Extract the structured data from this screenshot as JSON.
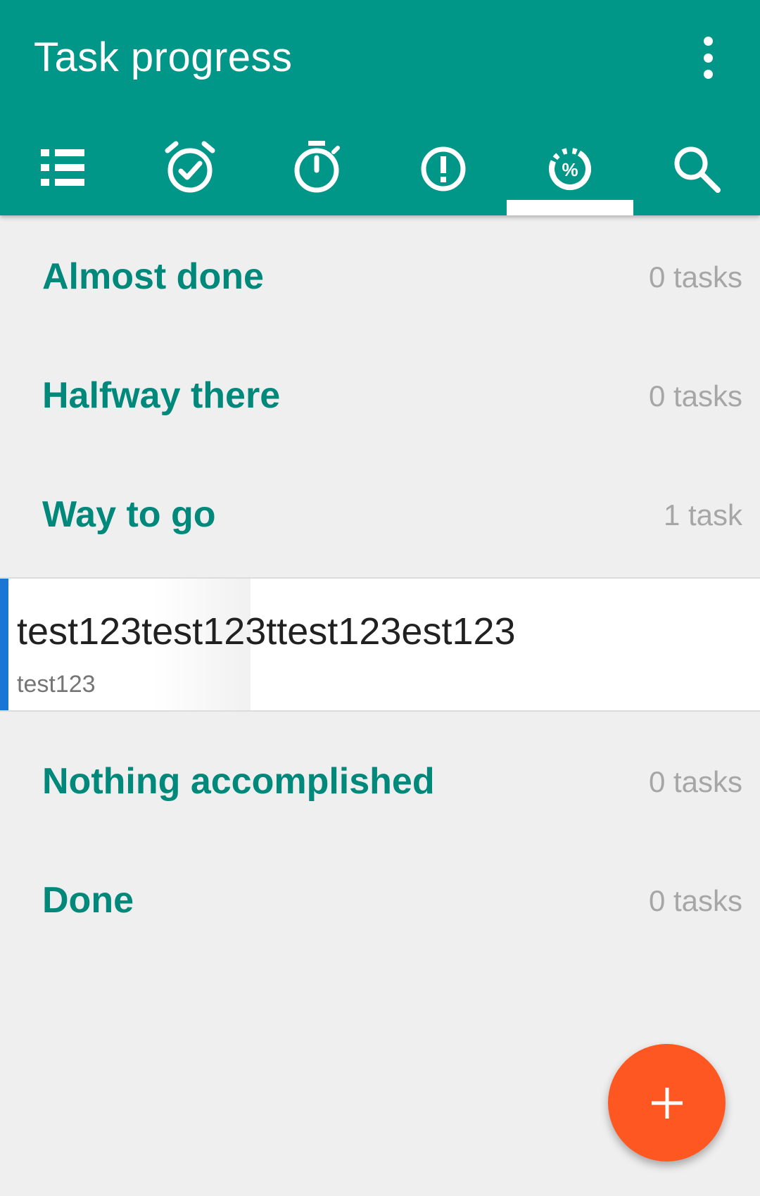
{
  "app": {
    "title": "Task progress",
    "accent_color": "#009688",
    "fab_color": "#ff5722"
  },
  "toolbar": {
    "overflow_icon": "more-vert-icon"
  },
  "tabs": [
    {
      "icon": "list-icon",
      "selected": false
    },
    {
      "icon": "alarm-check-icon",
      "selected": false
    },
    {
      "icon": "timer-icon",
      "selected": false
    },
    {
      "icon": "priority-exclamation-icon",
      "selected": false
    },
    {
      "icon": "progress-percent-icon",
      "selected": true
    },
    {
      "icon": "search-icon",
      "selected": false
    }
  ],
  "sections": [
    {
      "title": "Almost done",
      "count": "0 tasks"
    },
    {
      "title": "Halfway there",
      "count": "0 tasks"
    },
    {
      "title": "Way to go",
      "count": "1 task"
    },
    {
      "title": "Nothing accomplished",
      "count": "0 tasks"
    },
    {
      "title": "Done",
      "count": "0 tasks"
    }
  ],
  "tasks": [
    {
      "name": "test123test123ttest123est123",
      "subtitle": "test123",
      "priority_color": "#1976d2"
    }
  ],
  "fab": {
    "icon": "add-icon"
  }
}
